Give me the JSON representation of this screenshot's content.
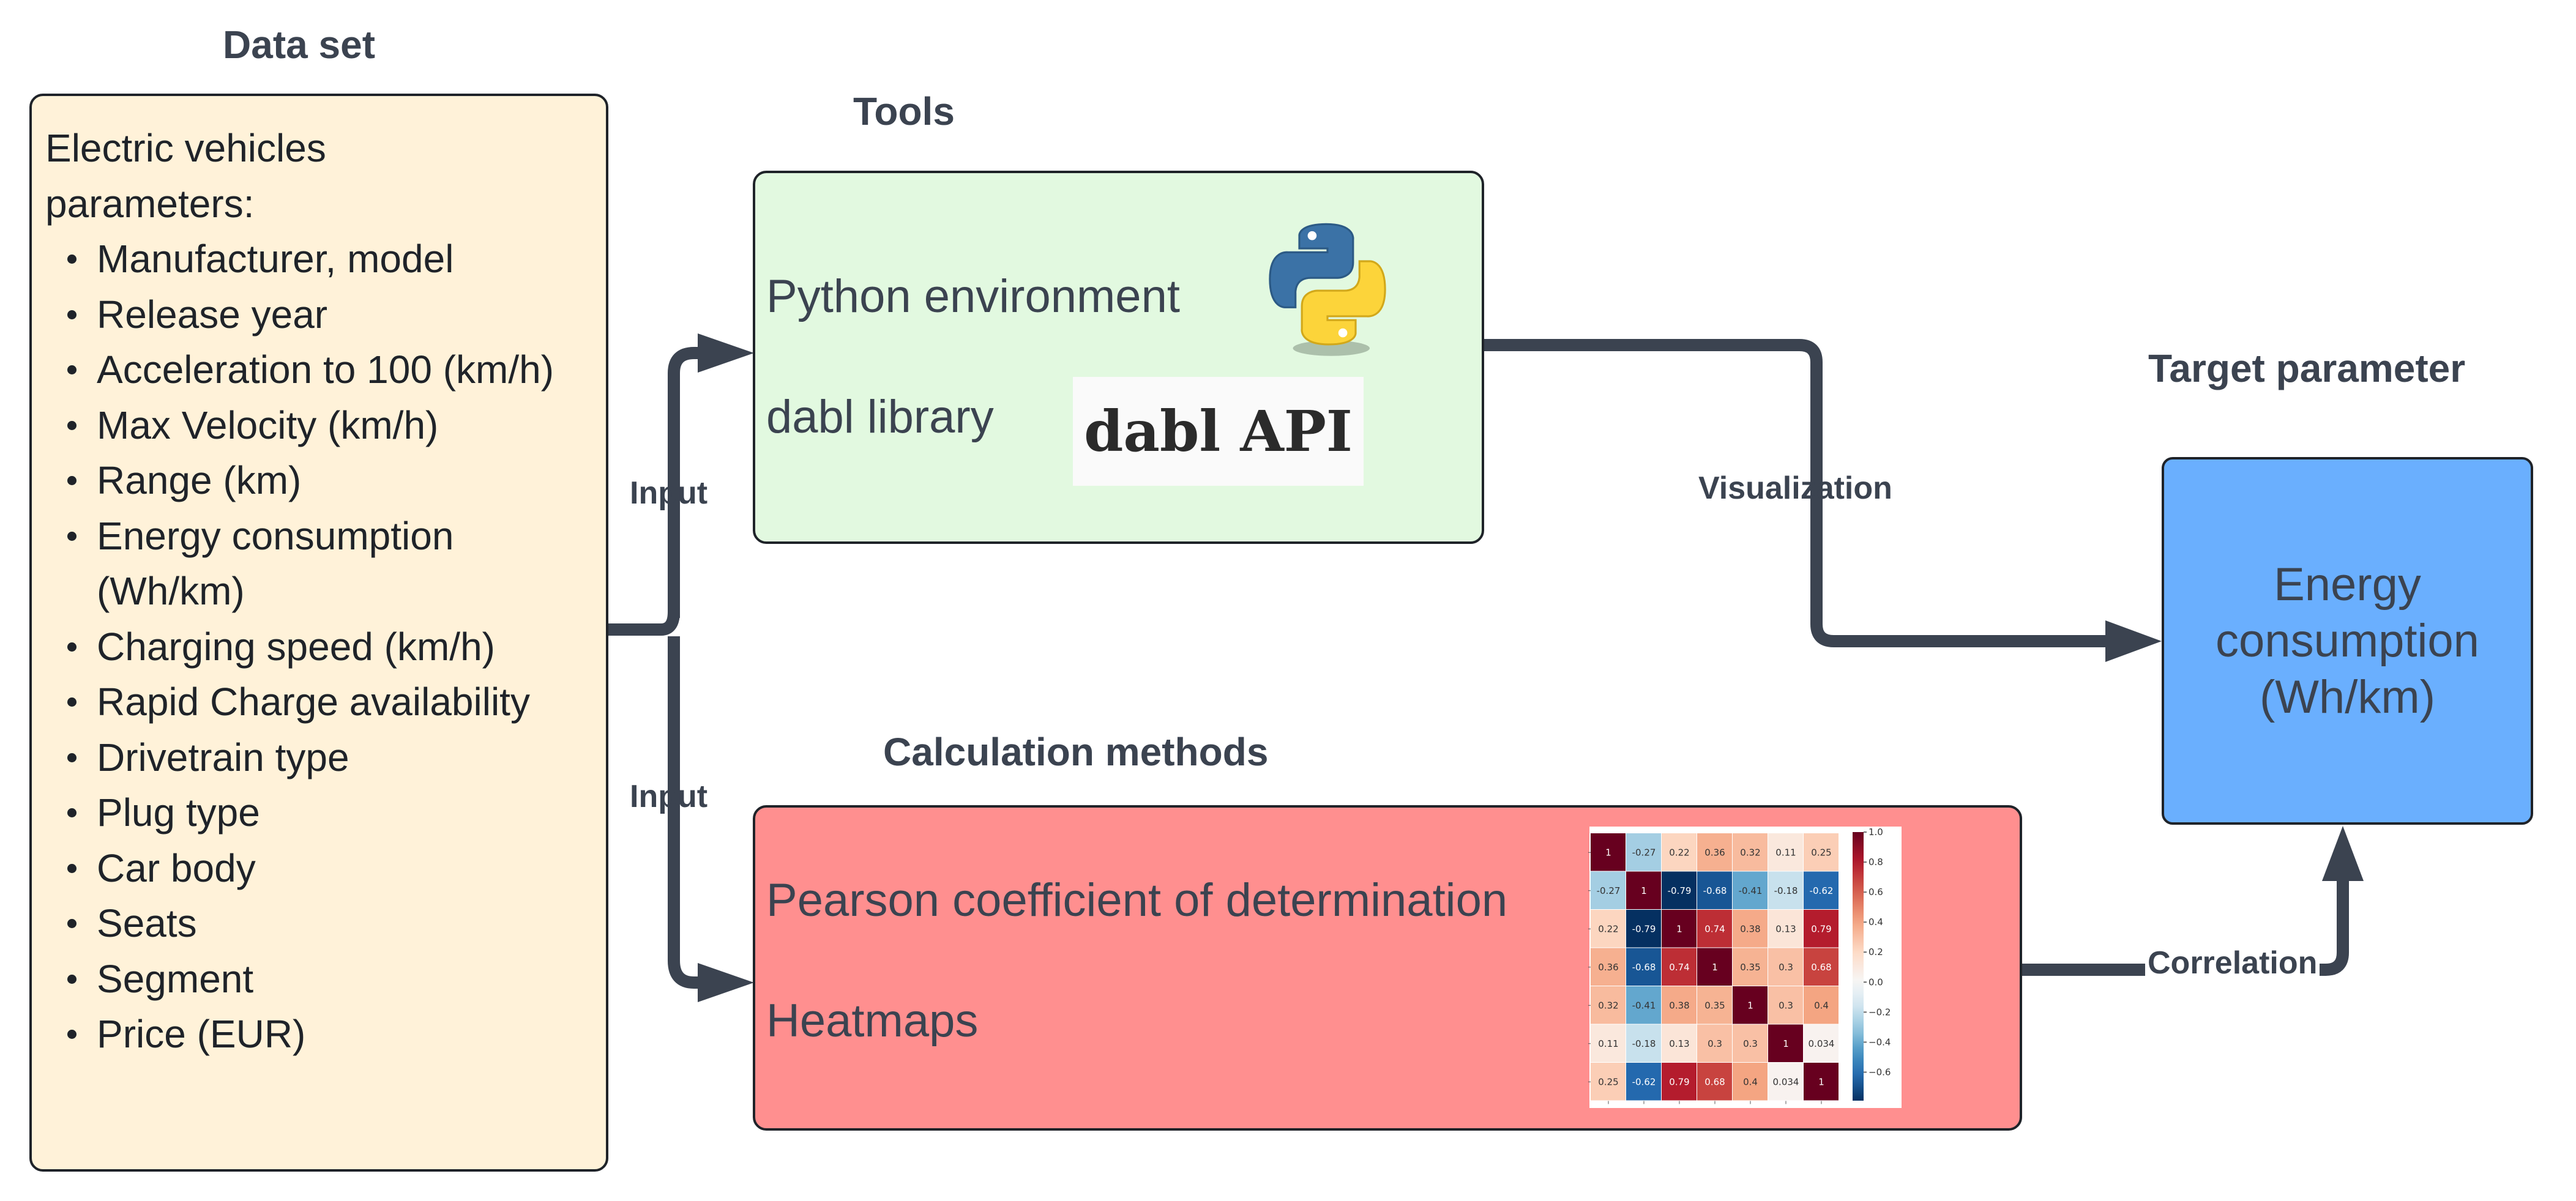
{
  "dataset": {
    "title": "Data set",
    "heading": "Electric vehicles parameters:",
    "items": [
      "Manufacturer, model",
      "Release year",
      "Acceleration to 100 (km/h)",
      "Max Velocity (km/h)",
      "Range (km)",
      "Energy consumption (Wh/km)",
      "Charging speed (km/h)",
      "Rapid Charge availability",
      "Drivetrain type",
      "Plug type",
      "Car body",
      "Seats",
      "Segment",
      "Price (EUR)"
    ],
    "fill": "#fff2d9"
  },
  "tools": {
    "title": "Tools",
    "python_label": "Python environment",
    "dabl_label": "dabl library",
    "dabl_logo_text": "dabl API",
    "python_logo": "python-logo-icon",
    "fill": "#e2f9e0"
  },
  "calc": {
    "title": "Calculation methods",
    "pearson_label": "Pearson coefficient of determination",
    "heatmaps_label": "Heatmaps",
    "fill": "#ff8f8f"
  },
  "target": {
    "title": "Target parameter",
    "line1": "Energy",
    "line2": "consumption",
    "line3": "(Wh/km)",
    "fill": "#6aaffe"
  },
  "connectors": {
    "input_top": "Input",
    "input_bottom": "Input",
    "visualization": "Visualization",
    "correlation": "Correlation",
    "color": "#3b4350"
  },
  "heatmap": {
    "colormap": "RdBu_r",
    "vmin": -0.79,
    "vmax": 1.0,
    "matrix": [
      [
        1,
        -0.27,
        0.22,
        0.36,
        0.32,
        0.11,
        0.25
      ],
      [
        -0.27,
        1,
        -0.79,
        -0.68,
        -0.41,
        -0.18,
        -0.62
      ],
      [
        0.22,
        -0.79,
        1,
        0.74,
        0.38,
        0.13,
        0.79
      ],
      [
        0.36,
        -0.68,
        0.74,
        1,
        0.35,
        0.3,
        0.68
      ],
      [
        0.32,
        -0.41,
        0.38,
        0.35,
        1,
        0.3,
        0.4
      ],
      [
        0.11,
        -0.18,
        0.13,
        0.3,
        0.3,
        1,
        0.034
      ],
      [
        0.25,
        -0.62,
        0.79,
        0.68,
        0.4,
        0.034,
        1
      ]
    ],
    "colorbar_ticks": [
      "1.0",
      "0.8",
      "0.6",
      "0.4",
      "0.2",
      "0.0",
      "−0.2",
      "−0.4",
      "−0.6"
    ],
    "colorbar_tick_values": [
      1.0,
      0.8,
      0.6,
      0.4,
      0.2,
      0.0,
      -0.2,
      -0.4,
      -0.6
    ]
  }
}
